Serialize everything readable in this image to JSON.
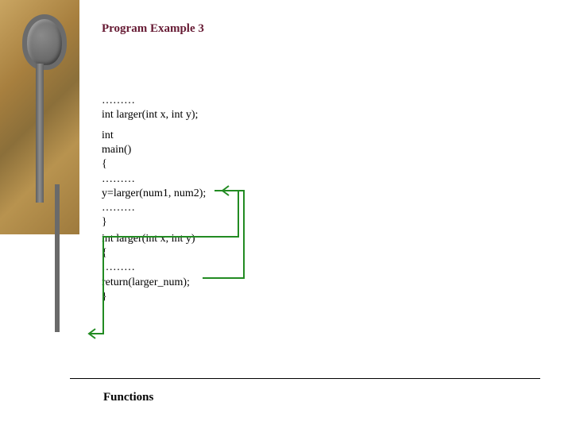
{
  "title": "Program Example 3",
  "code": {
    "decl_dots": "………",
    "prototype": "int larger(int x, int y);",
    "main_int": "int",
    "main_sig": "main()",
    "main_open": "{",
    "main_dots1": "  ………",
    "main_call": "  y=larger(num1, num2);",
    "main_dots2": "  ………",
    "main_close": "}",
    "func_sig": "int larger(int x, int y)",
    "func_open": "{",
    "func_dots": "  ………",
    "func_return": "  return(larger_num);",
    "func_close": "}"
  },
  "footer": "Functions",
  "arrow_color": "#228B22"
}
